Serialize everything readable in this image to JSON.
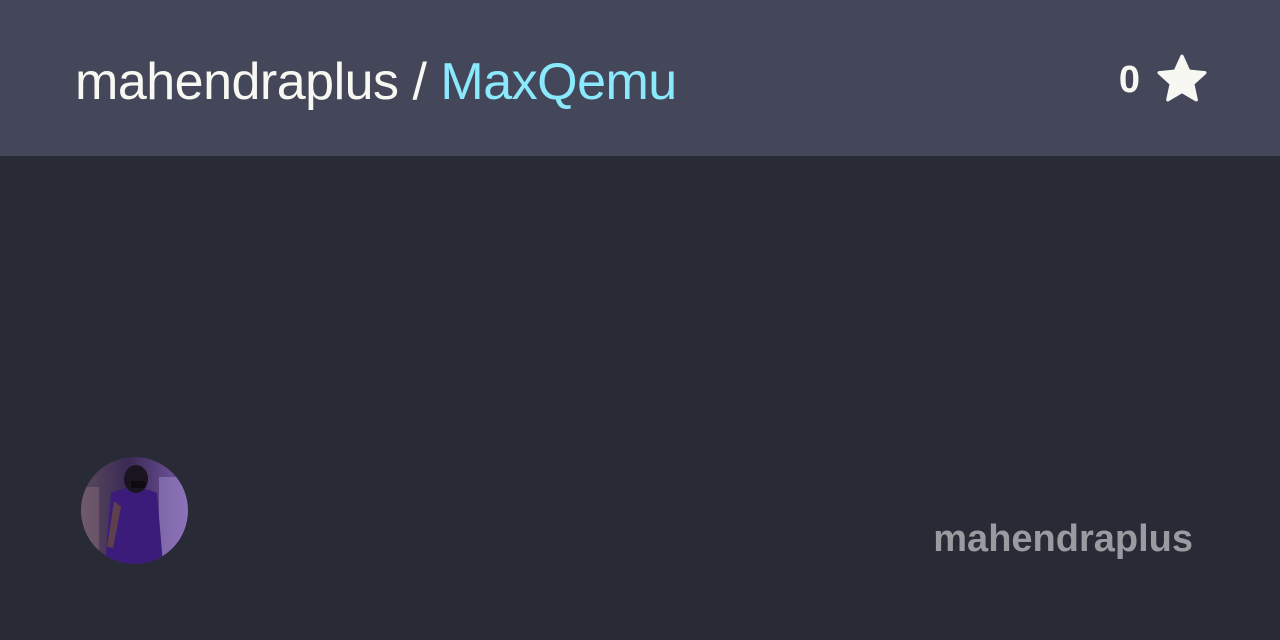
{
  "header": {
    "owner": "mahendraplus",
    "separator": " / ",
    "repo": "MaxQemu"
  },
  "stars": {
    "count": "0",
    "icon": "star-icon"
  },
  "footer": {
    "avatar_icon": "avatar",
    "author": "mahendraplus"
  },
  "colors": {
    "background": "#282a36",
    "header_background": "#44475a",
    "text": "#f8f8f2",
    "accent": "#8be9fd",
    "muted": "#9a9aa1"
  }
}
